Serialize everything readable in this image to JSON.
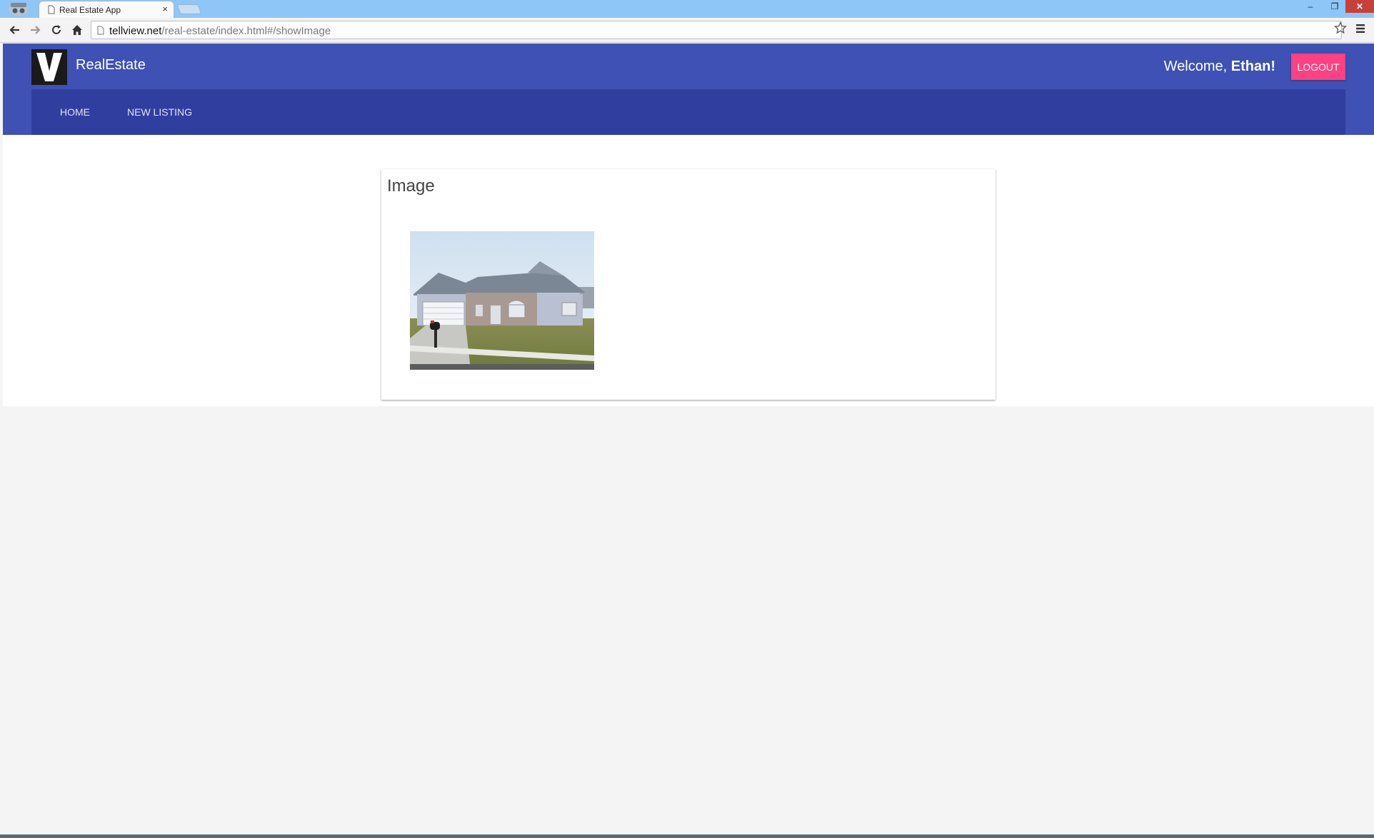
{
  "browser": {
    "tab_title": "Real Estate App",
    "tab_close_glyph": "×",
    "url_host": "tellview.net",
    "url_path": "/real-estate/index.html#/showImage",
    "window_controls": {
      "minimize": "–",
      "maximize": "❐",
      "close": "✕"
    },
    "icons": [
      "incognito-icon",
      "page-icon",
      "back-icon",
      "forward-icon",
      "reload-icon",
      "home-icon",
      "star-icon",
      "menu-icon"
    ]
  },
  "header": {
    "logo_letter": "V",
    "brand": "RealEstate",
    "welcome_prefix": "Welcome, ",
    "user_name": "Ethan!",
    "logout_label": "LOGOUT"
  },
  "nav": {
    "items": [
      {
        "label": "HOME"
      },
      {
        "label": "NEW LISTING"
      }
    ]
  },
  "card": {
    "title": "Image",
    "image_alt": "House listing photo"
  },
  "colors": {
    "primary": "#3f51b5",
    "primary_dark": "#303f9f",
    "accent": "#ff4081",
    "page_bg": "#f4f4f4"
  }
}
